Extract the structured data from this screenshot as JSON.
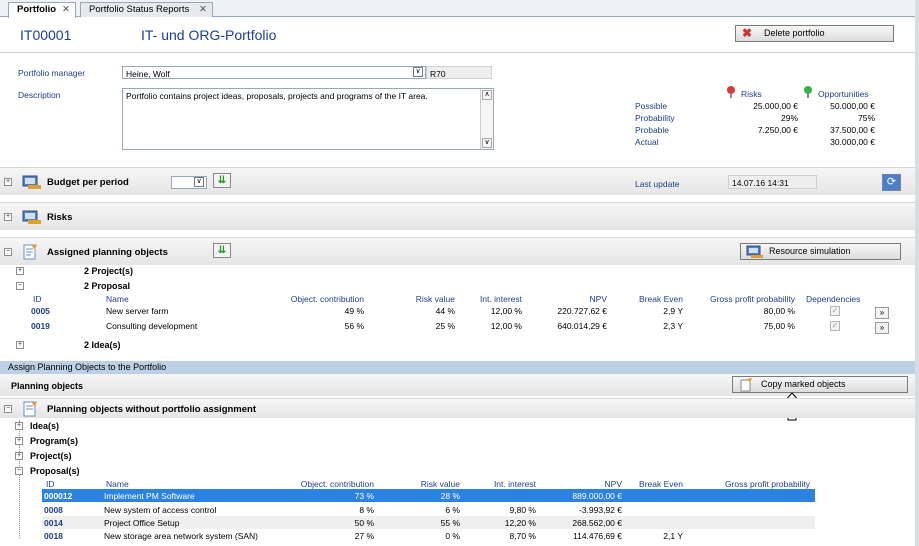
{
  "tabs": [
    {
      "label": "Portfolio"
    },
    {
      "label": "Portfolio Status Reports"
    }
  ],
  "header": {
    "id": "IT00001",
    "title": "IT- und ORG-Portfolio",
    "delete_label": "Delete portfolio"
  },
  "form": {
    "manager_label": "Portfolio manager",
    "manager_value": "Heine, Wolf",
    "manager_code": "R70",
    "description_label": "Description",
    "description_value": "Portfolio contains project ideas, proposals, projects and programs of the IT area."
  },
  "risks_opps": {
    "risks_label": "Risks",
    "opps_label": "Opportunities",
    "rows": [
      {
        "label": "Possible",
        "risk": "25.000,00 €",
        "opp": "50.000,00 €"
      },
      {
        "label": "Probability",
        "risk": "29%",
        "opp": "75%"
      },
      {
        "label": "Probable",
        "risk": "7.250,00 €",
        "opp": "37.500,00 €"
      },
      {
        "label": "Actual",
        "risk": "",
        "opp": "30.000,00 €"
      }
    ],
    "colors": {
      "risk": "#d83a3a",
      "opp": "#35b54a"
    }
  },
  "budget": {
    "title": "Budget per period",
    "last_update_label": "Last update",
    "last_update_value": "14.07.16 14:31"
  },
  "risks_section": {
    "title": "Risks"
  },
  "assigned": {
    "title": "Assigned planning objects",
    "resource_label": "Resource simulation",
    "groups": [
      {
        "label": "2 Project(s)"
      },
      {
        "label": "2 Proposal"
      },
      {
        "label": "2 Idea(s)"
      }
    ],
    "columns": [
      "ID",
      "Name",
      "Object. contribution",
      "Risk value",
      "Int. interest",
      "NPV",
      "Break Even",
      "Gross profit probability",
      "Dependencies"
    ],
    "rows": [
      {
        "id": "0005",
        "name": "New server farm",
        "contrib": "49 %",
        "risk": "44 %",
        "interest": "12,00 %",
        "npv": "220.727,62 €",
        "be": "2,9 Y",
        "gpp": "80,00 %"
      },
      {
        "id": "0019",
        "name": "Consulting development",
        "contrib": "56 %",
        "risk": "25 %",
        "interest": "12,00 %",
        "npv": "640.014,29 €",
        "be": "2,3 Y",
        "gpp": "75,00 %"
      }
    ]
  },
  "assign": {
    "bar_title": "Assign Planning Objects to the Portfolio",
    "planning_objects_label": "Planning objects",
    "copy_label": "Copy marked objects",
    "without_title": "Planning objects without portfolio assignment",
    "groups": [
      {
        "label": "Idea(s)"
      },
      {
        "label": "Program(s)"
      },
      {
        "label": "Project(s)"
      },
      {
        "label": "Proposal(s)"
      }
    ],
    "columns": [
      "ID",
      "Name",
      "Object. contribution",
      "Risk value",
      "Int. interest",
      "NPV",
      "Break Even",
      "Gross profit probability"
    ],
    "rows": [
      {
        "id": "000012",
        "name": "Implement PM Software",
        "contrib": "73 %",
        "risk": "28 %",
        "interest": "",
        "npv": "889.000,00 €",
        "be": "",
        "gpp": ""
      },
      {
        "id": "0008",
        "name": "New system of access control",
        "contrib": "8 %",
        "risk": "6 %",
        "interest": "9,80 %",
        "npv": "-3.993,92 €",
        "be": "",
        "gpp": ""
      },
      {
        "id": "0014",
        "name": "Project Office Setup",
        "contrib": "50 %",
        "risk": "55 %",
        "interest": "12,20 %",
        "npv": "268.562,00 €",
        "be": "",
        "gpp": ""
      },
      {
        "id": "0018",
        "name": "New storage area network system (SAN)",
        "contrib": "27 %",
        "risk": "0 %",
        "interest": "8,70 %",
        "npv": "114.476,69 €",
        "be": "2,1 Y",
        "gpp": ""
      }
    ]
  }
}
